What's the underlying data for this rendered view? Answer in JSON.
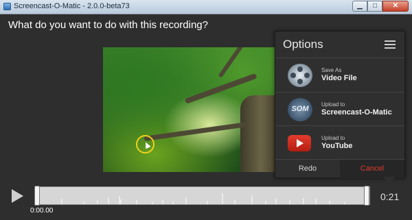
{
  "window": {
    "title": "Screencast-O-Matic - 2.0.0-beta73",
    "controls": {
      "minimize": "▁",
      "maximize": "□",
      "close": "✕"
    }
  },
  "question": "What do you want to do with this recording?",
  "options": {
    "title": "Options",
    "items": [
      {
        "small": "Save As",
        "big": "Video File",
        "icon": "film-reel-icon"
      },
      {
        "small": "Upload to",
        "big": "Screencast-O-Matic",
        "icon": "som-logo-icon",
        "icon_text": "SOM"
      },
      {
        "small": "Upload to",
        "big": "YouTube",
        "icon": "youtube-icon"
      }
    ],
    "redo_label": "Redo",
    "cancel_label": "Cancel"
  },
  "timeline": {
    "start_time": "0:00.00",
    "end_time": "0:21"
  },
  "colors": {
    "cancel": "#e23b2e",
    "youtube": "#d8261a",
    "cursor_ring": "#f2d21c"
  }
}
